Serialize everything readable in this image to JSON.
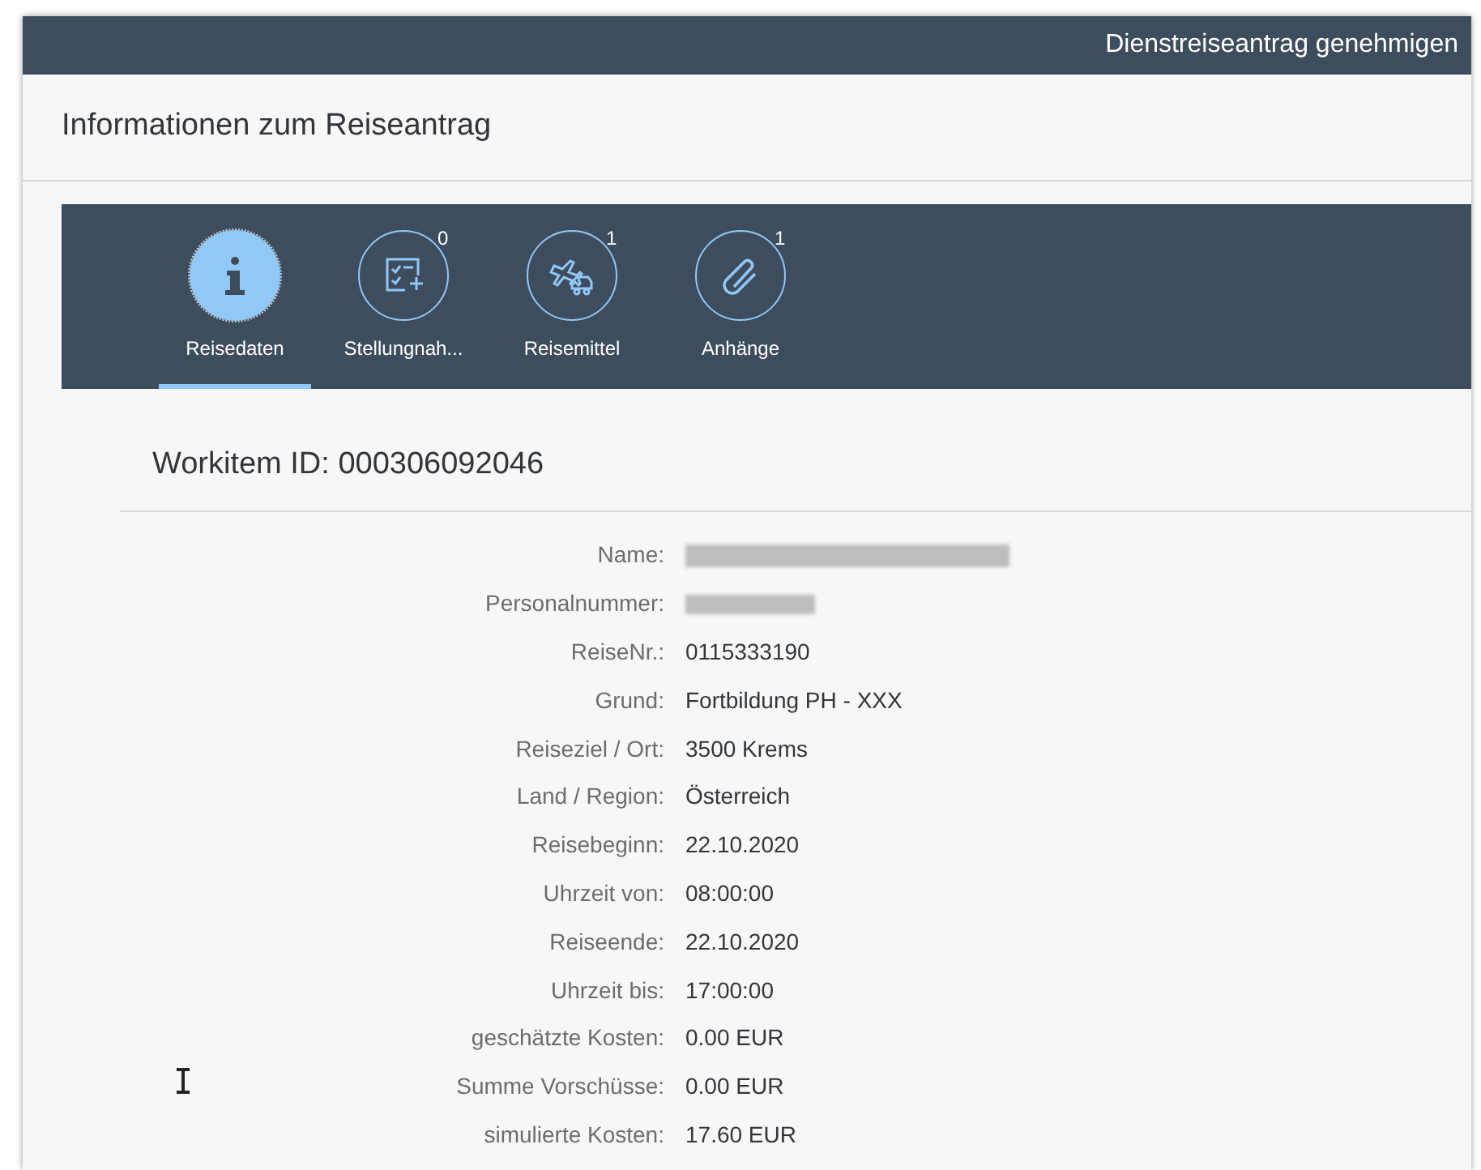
{
  "header": {
    "title": "Dienstreiseantrag genehmigen"
  },
  "section": {
    "title": "Informationen zum Reiseantrag"
  },
  "tabs": [
    {
      "kind": "info",
      "label": "Reisedaten",
      "selected": true
    },
    {
      "kind": "checklist",
      "label": "Stellungnah...",
      "count": "0",
      "selected": false
    },
    {
      "kind": "travel",
      "label": "Reisemittel",
      "count": "1",
      "selected": false
    },
    {
      "kind": "attachment",
      "label": "Anhänge",
      "count": "1",
      "selected": false
    }
  ],
  "workitem": {
    "title": "Workitem ID: 000306092046"
  },
  "fields": [
    {
      "label": "Name:",
      "kind": "redacted"
    },
    {
      "label": "Personalnummer:",
      "kind": "redacted-short"
    },
    {
      "label": "ReiseNr.:",
      "kind": "text",
      "value": "0115333190"
    },
    {
      "label": "Grund:",
      "kind": "text",
      "value": "Fortbildung PH - XXX"
    },
    {
      "label": "Reiseziel / Ort:",
      "kind": "text",
      "value": "3500 Krems"
    },
    {
      "label": "Land / Region:",
      "kind": "text",
      "value": "Österreich"
    },
    {
      "label": "Reisebeginn:",
      "kind": "text",
      "value": "22.10.2020"
    },
    {
      "label": "Uhrzeit von:",
      "kind": "text",
      "value": "08:00:00"
    },
    {
      "label": "Reiseende:",
      "kind": "text",
      "value": "22.10.2020"
    },
    {
      "label": "Uhrzeit bis:",
      "kind": "text",
      "value": "17:00:00"
    },
    {
      "label": "geschätzte Kosten:",
      "kind": "text",
      "value": "0.00 EUR"
    },
    {
      "label": "Summe Vorschüsse:",
      "kind": "text",
      "value": "0.00 EUR"
    },
    {
      "label": "simulierte Kosten:",
      "kind": "text",
      "value": "17.60 EUR"
    }
  ]
}
